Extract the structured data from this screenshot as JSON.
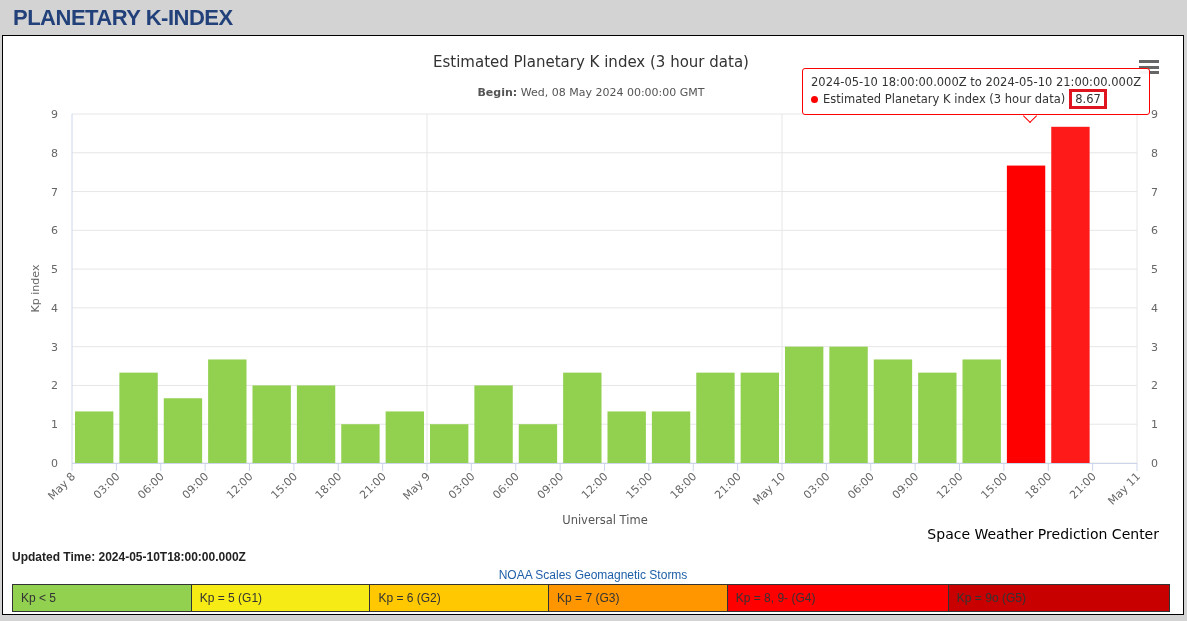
{
  "header": {
    "title": "PLANETARY K-INDEX"
  },
  "chart": {
    "subtitle_label": "Begin:",
    "subtitle": "Wed, 08 May 2024 00:00:00 GMT",
    "credit": "Space Weather Prediction Center",
    "axis_end_label": "May 11",
    "right_axis_labels": [
      "9",
      "8",
      "7",
      "6",
      "5",
      "4",
      "3",
      "2",
      "1",
      "0"
    ],
    "tooltip": {
      "heading": "2024-05-10 18:00:00.000Z to 2024-05-10 21:00:00.000Z",
      "value": "8.67",
      "value_highlighted": true,
      "color": "#ff0000"
    },
    "chart_data": {
      "type": "bar",
      "title": "Estimated Planetary K index (3 hour data)",
      "xlabel": "Universal Time",
      "ylabel": "Kp index",
      "ylim": [
        0,
        9
      ],
      "grid": true,
      "yticks": [
        0,
        1,
        2,
        3,
        4,
        5,
        6,
        7,
        8,
        9
      ],
      "categories": [
        "May 8",
        "03:00",
        "06:00",
        "09:00",
        "12:00",
        "15:00",
        "18:00",
        "21:00",
        "May 9",
        "03:00",
        "06:00",
        "09:00",
        "12:00",
        "15:00",
        "18:00",
        "21:00",
        "May 10",
        "03:00",
        "06:00",
        "09:00",
        "12:00",
        "15:00",
        "18:00",
        "21:00"
      ],
      "series": [
        {
          "name": "Estimated Planetary K index (3 hour data)",
          "color": "#92d050",
          "values": [
            1.33,
            2.33,
            1.67,
            2.67,
            2,
            2,
            1,
            1.33,
            1,
            2,
            1,
            2.33,
            1.33,
            1.33,
            2.33,
            2.33,
            3,
            3,
            2.67,
            2.33,
            2.67,
            7.67,
            8.67,
            null
          ],
          "colors": [
            null,
            null,
            null,
            null,
            null,
            null,
            null,
            null,
            null,
            null,
            null,
            null,
            null,
            null,
            null,
            null,
            null,
            null,
            null,
            null,
            null,
            "#ff0000",
            "#ff1a1a",
            null
          ]
        }
      ]
    }
  },
  "updated": {
    "text": "Updated Time: 2024-05-10T18:00:00.000Z"
  },
  "scale": {
    "title": "NOAA Scales Geomagnetic Storms",
    "items": [
      {
        "label": "Kp < 5",
        "color": "#92d050"
      },
      {
        "label": "Kp = 5 (G1)",
        "color": "#f6eb14"
      },
      {
        "label": "Kp = 6 (G2)",
        "color": "#ffc800"
      },
      {
        "label": "Kp = 7 (G3)",
        "color": "#ff9600"
      },
      {
        "label": "Kp = 8, 9- (G4)",
        "color": "#ff0000"
      },
      {
        "label": "Kp = 9o (G5)",
        "color": "#c80000"
      }
    ]
  }
}
